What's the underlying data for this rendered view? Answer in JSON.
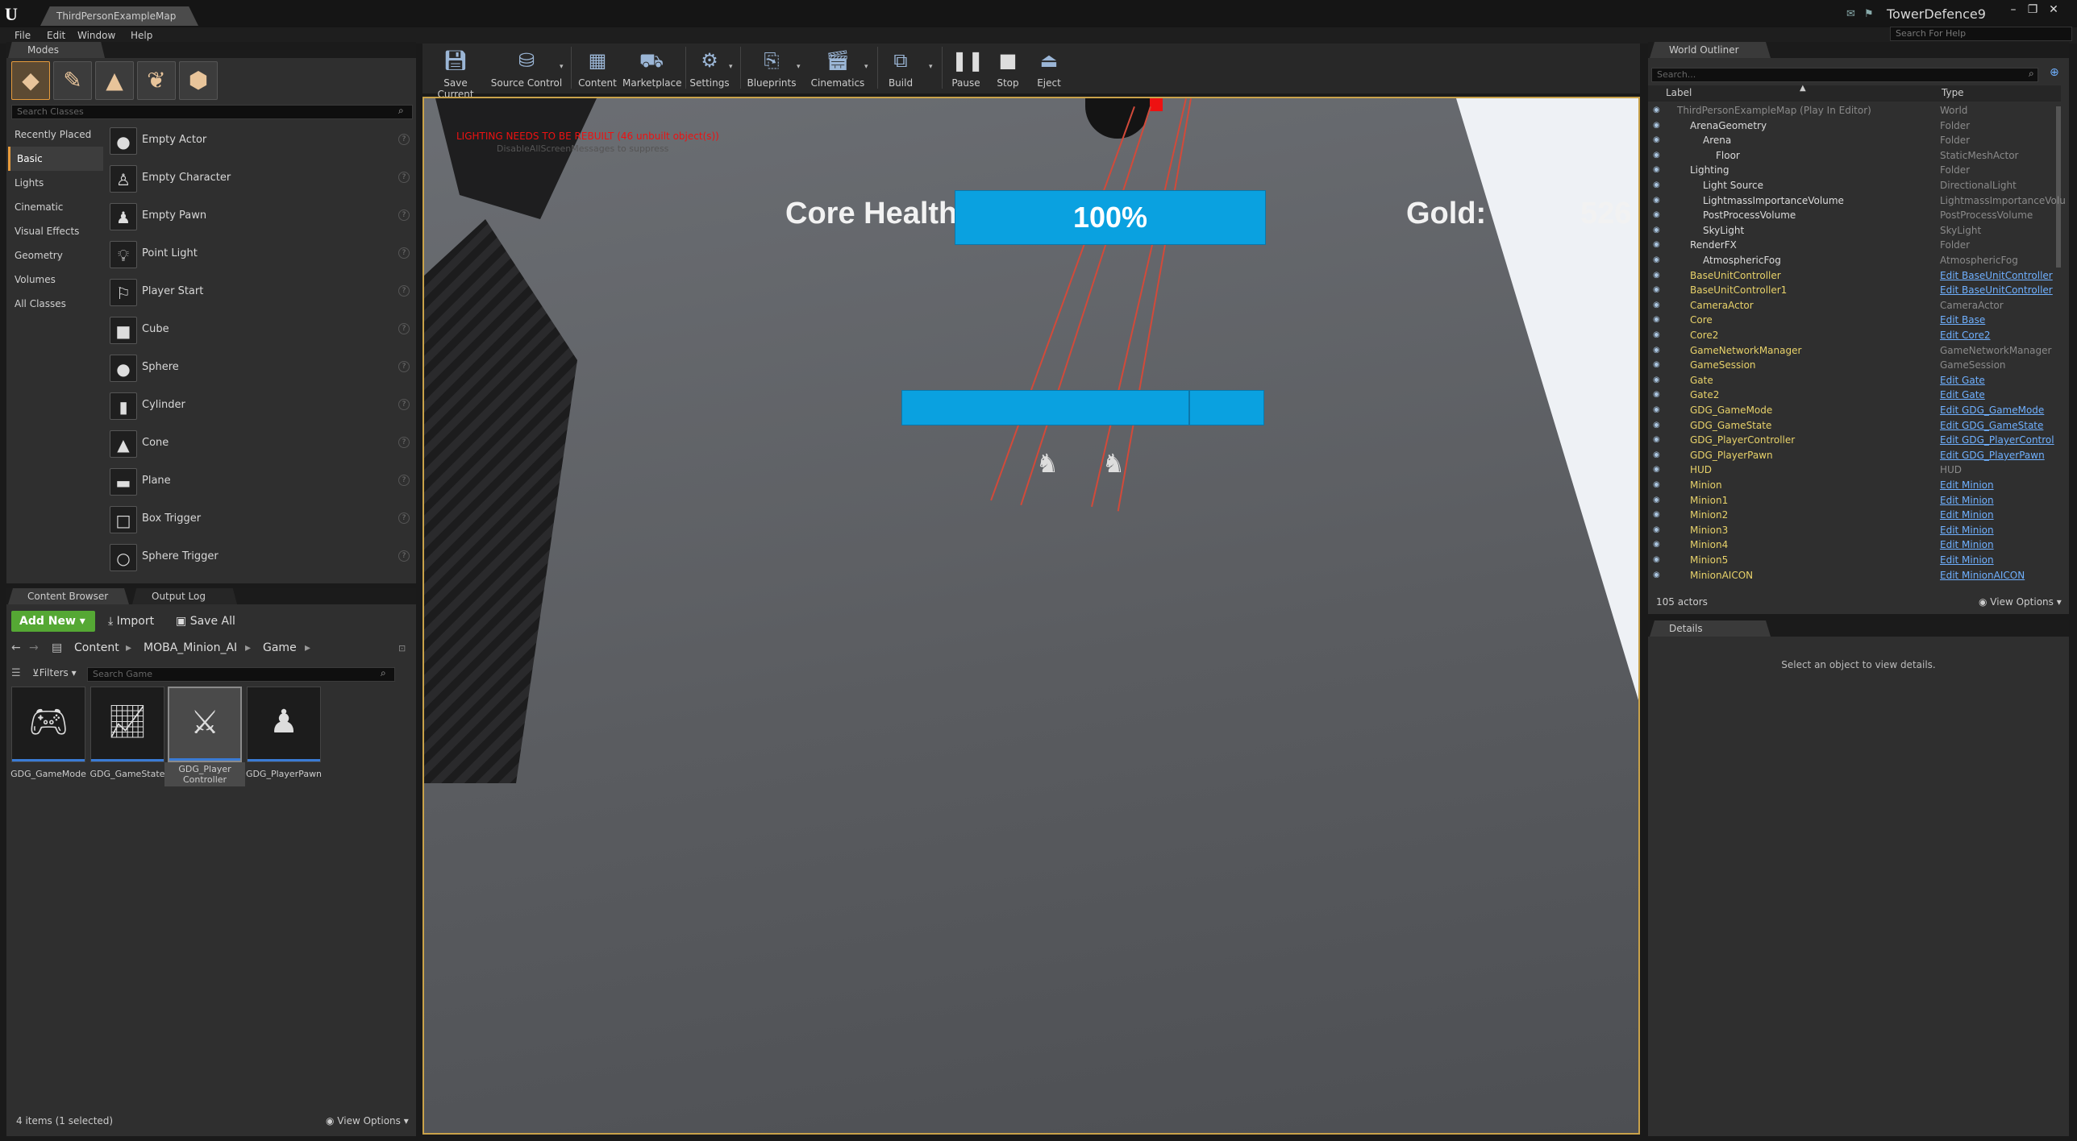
{
  "window": {
    "doc_tab": "ThirdPersonExampleMap",
    "project_name": "TowerDefence9",
    "help_placeholder": "Search For Help",
    "buttons": {
      "minimize": "–",
      "maximize": "❐",
      "close": "✕"
    }
  },
  "menu": [
    "File",
    "Edit",
    "Window",
    "Help"
  ],
  "modes": {
    "tab": "Modes",
    "search_placeholder": "Search Classes",
    "categories": [
      "Recently Placed",
      "Basic",
      "Lights",
      "Cinematic",
      "Visual Effects",
      "Geometry",
      "Volumes",
      "All Classes"
    ],
    "active_category": "Basic",
    "items": [
      {
        "label": "Empty Actor",
        "icon": "sphere-icon"
      },
      {
        "label": "Empty Character",
        "icon": "character-icon"
      },
      {
        "label": "Empty Pawn",
        "icon": "pawn-icon"
      },
      {
        "label": "Point Light",
        "icon": "light-bulb-icon"
      },
      {
        "label": "Player Start",
        "icon": "player-start-icon"
      },
      {
        "label": "Cube",
        "icon": "cube-icon"
      },
      {
        "label": "Sphere",
        "icon": "sphere-icon"
      },
      {
        "label": "Cylinder",
        "icon": "cylinder-icon"
      },
      {
        "label": "Cone",
        "icon": "cone-icon"
      },
      {
        "label": "Plane",
        "icon": "plane-icon"
      },
      {
        "label": "Box Trigger",
        "icon": "box-trigger-icon"
      },
      {
        "label": "Sphere Trigger",
        "icon": "sphere-trigger-icon"
      }
    ]
  },
  "toolbar": [
    {
      "label": "Save Current",
      "icon": "save-icon"
    },
    {
      "label": "Source Control",
      "icon": "source-control-icon"
    },
    {
      "label": "Content",
      "icon": "content-icon"
    },
    {
      "label": "Marketplace",
      "icon": "marketplace-icon"
    },
    {
      "label": "Settings",
      "icon": "settings-icon"
    },
    {
      "label": "Blueprints",
      "icon": "blueprints-icon"
    },
    {
      "label": "Cinematics",
      "icon": "cinematics-icon"
    },
    {
      "label": "Build",
      "icon": "build-icon"
    },
    {
      "label": "Pause",
      "icon": "pause-icon"
    },
    {
      "label": "Stop",
      "icon": "stop-icon"
    },
    {
      "label": "Eject",
      "icon": "eject-icon"
    }
  ],
  "viewport": {
    "lighting_warning": "LIGHTING NEEDS TO BE REBUILT (46 unbuilt object(s))",
    "lighting_sub": "DisableAllScreenMessages to suppress",
    "hud": {
      "core_health_label": "Core Health:",
      "core_health_value": "100%",
      "core_health_fraction": 1.0,
      "gold_label": "Gold:",
      "gold_value": "526"
    }
  },
  "outliner": {
    "tab": "World Outliner",
    "search_placeholder": "Search...",
    "col_label": "Label",
    "col_type": "Type",
    "actor_count": "105 actors",
    "view_options": "View Options",
    "rows": [
      {
        "name": "ThirdPersonExampleMap (Play In Editor)",
        "type": "World",
        "indent": 0,
        "style": "gray",
        "type_link": false
      },
      {
        "name": "ArenaGeometry",
        "type": "Folder",
        "indent": 1,
        "style": "white",
        "type_link": false
      },
      {
        "name": "Arena",
        "type": "Folder",
        "indent": 2,
        "style": "white",
        "type_link": false
      },
      {
        "name": "Floor",
        "type": "StaticMeshActor",
        "indent": 3,
        "style": "white",
        "type_link": false
      },
      {
        "name": "Lighting",
        "type": "Folder",
        "indent": 1,
        "style": "white",
        "type_link": false
      },
      {
        "name": "Light Source",
        "type": "DirectionalLight",
        "indent": 2,
        "style": "white",
        "type_link": false
      },
      {
        "name": "LightmassImportanceVolume",
        "type": "LightmassImportanceVolu",
        "indent": 2,
        "style": "white",
        "type_link": false
      },
      {
        "name": "PostProcessVolume",
        "type": "PostProcessVolume",
        "indent": 2,
        "style": "white",
        "type_link": false
      },
      {
        "name": "SkyLight",
        "type": "SkyLight",
        "indent": 2,
        "style": "white",
        "type_link": false
      },
      {
        "name": "RenderFX",
        "type": "Folder",
        "indent": 1,
        "style": "white",
        "type_link": false
      },
      {
        "name": "AtmosphericFog",
        "type": "AtmosphericFog",
        "indent": 2,
        "style": "white",
        "type_link": false
      },
      {
        "name": "BaseUnitController",
        "type": "Edit BaseUnitController",
        "indent": 1,
        "style": "yellow",
        "type_link": true
      },
      {
        "name": "BaseUnitController1",
        "type": "Edit BaseUnitController",
        "indent": 1,
        "style": "yellow",
        "type_link": true
      },
      {
        "name": "CameraActor",
        "type": "CameraActor",
        "indent": 1,
        "style": "yellow",
        "type_link": false
      },
      {
        "name": "Core",
        "type": "Edit Base",
        "indent": 1,
        "style": "yellow",
        "type_link": true
      },
      {
        "name": "Core2",
        "type": "Edit Core2",
        "indent": 1,
        "style": "yellow",
        "type_link": true
      },
      {
        "name": "GameNetworkManager",
        "type": "GameNetworkManager",
        "indent": 1,
        "style": "yellow",
        "type_link": false
      },
      {
        "name": "GameSession",
        "type": "GameSession",
        "indent": 1,
        "style": "yellow",
        "type_link": false
      },
      {
        "name": "Gate",
        "type": "Edit Gate",
        "indent": 1,
        "style": "yellow",
        "type_link": true
      },
      {
        "name": "Gate2",
        "type": "Edit Gate",
        "indent": 1,
        "style": "yellow",
        "type_link": true
      },
      {
        "name": "GDG_GameMode",
        "type": "Edit GDG_GameMode",
        "indent": 1,
        "style": "yellow",
        "type_link": true
      },
      {
        "name": "GDG_GameState",
        "type": "Edit GDG_GameState",
        "indent": 1,
        "style": "yellow",
        "type_link": true
      },
      {
        "name": "GDG_PlayerController",
        "type": "Edit GDG_PlayerControl",
        "indent": 1,
        "style": "yellow",
        "type_link": true
      },
      {
        "name": "GDG_PlayerPawn",
        "type": "Edit GDG_PlayerPawn",
        "indent": 1,
        "style": "yellow",
        "type_link": true
      },
      {
        "name": "HUD",
        "type": "HUD",
        "indent": 1,
        "style": "yellow",
        "type_link": false
      },
      {
        "name": "Minion",
        "type": "Edit Minion",
        "indent": 1,
        "style": "yellow",
        "type_link": true
      },
      {
        "name": "Minion1",
        "type": "Edit Minion",
        "indent": 1,
        "style": "yellow",
        "type_link": true
      },
      {
        "name": "Minion2",
        "type": "Edit Minion",
        "indent": 1,
        "style": "yellow",
        "type_link": true
      },
      {
        "name": "Minion3",
        "type": "Edit Minion",
        "indent": 1,
        "style": "yellow",
        "type_link": true
      },
      {
        "name": "Minion4",
        "type": "Edit Minion",
        "indent": 1,
        "style": "yellow",
        "type_link": true
      },
      {
        "name": "Minion5",
        "type": "Edit Minion",
        "indent": 1,
        "style": "yellow",
        "type_link": true
      },
      {
        "name": "MinionAICON",
        "type": "Edit MinionAICON",
        "indent": 1,
        "style": "yellow",
        "type_link": true
      }
    ]
  },
  "details": {
    "tab": "Details",
    "empty_text": "Select an object to view details."
  },
  "content_browser": {
    "tabs": [
      "Content Browser",
      "Output Log"
    ],
    "add_new": "Add New",
    "import": "Import",
    "save_all": "Save All",
    "breadcrumb": [
      "Content",
      "MOBA_Minion_AI",
      "Game"
    ],
    "filters": "Filters",
    "search_placeholder": "Search Game",
    "assets": [
      {
        "label": "GDG_GameMode",
        "icon": "gamepad-icon",
        "selected": false
      },
      {
        "label": "GDG_GameState",
        "icon": "graph-icon",
        "selected": false
      },
      {
        "label": "GDG_Player Controller",
        "icon": "controller-icon",
        "selected": true
      },
      {
        "label": "GDG_PlayerPawn",
        "icon": "pawn-icon",
        "selected": false
      }
    ],
    "status": "4 items (1 selected)",
    "view_options": "View Options"
  },
  "colors": {
    "hud_bar": "#0aa1e0",
    "add_new": "#55a834",
    "accent": "#e79b3c",
    "outliner_name": "#e8d26a",
    "outliner_link": "#6fb0ff"
  }
}
